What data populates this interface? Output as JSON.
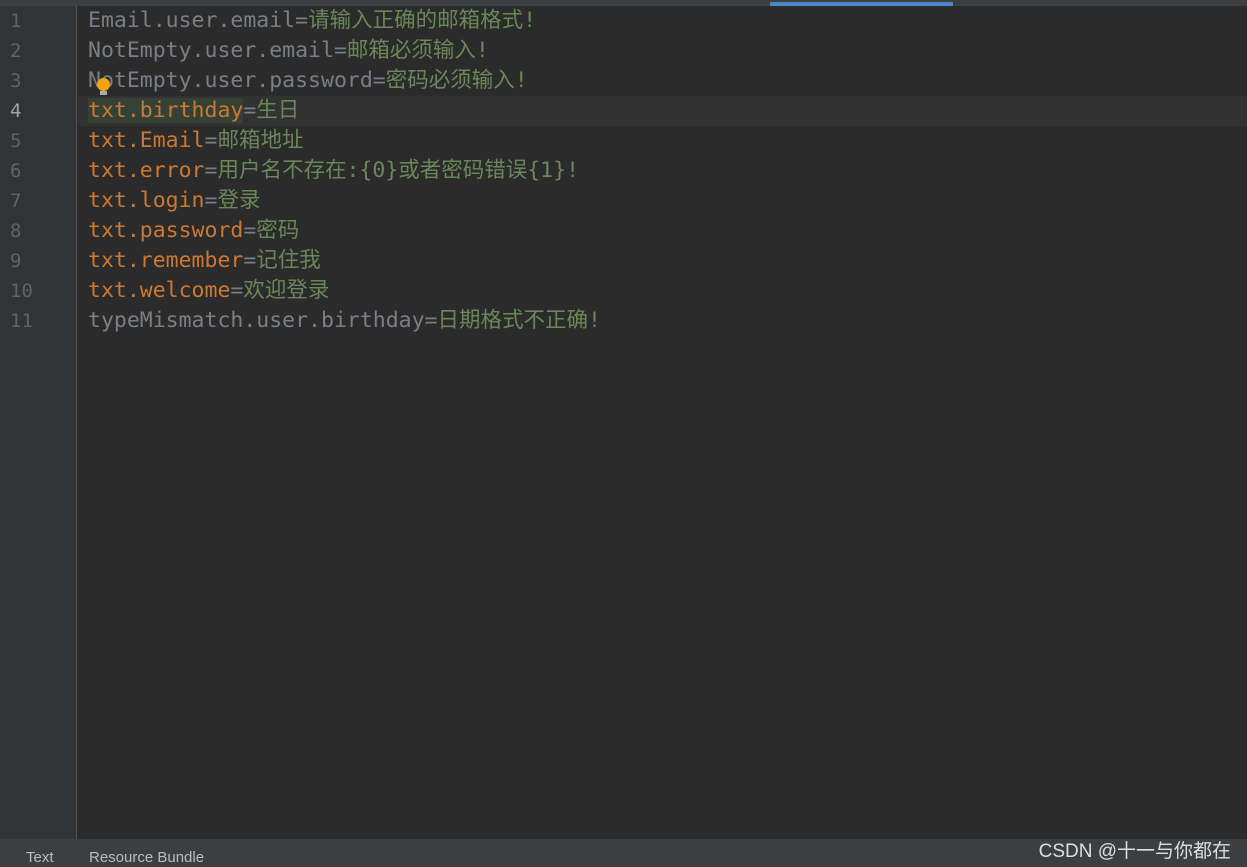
{
  "editor": {
    "current_line": 4,
    "lines": [
      {
        "n": "1",
        "key": "Email.user.email",
        "value": "请输入正确的邮箱格式!",
        "style": "gray"
      },
      {
        "n": "2",
        "key": "NotEmpty.user.email",
        "value": "邮箱必须输入!",
        "style": "gray"
      },
      {
        "n": "3",
        "key": "NotEmpty.user.password",
        "value": "密码必须输入!",
        "style": "gray"
      },
      {
        "n": "4",
        "key": "txt.birthday",
        "value": "生日",
        "style": "orange"
      },
      {
        "n": "5",
        "key": "txt.Email",
        "value": "邮箱地址",
        "style": "orange"
      },
      {
        "n": "6",
        "key": "txt.error",
        "value": "用户名不存在:{0}或者密码错误{1}!",
        "style": "orange"
      },
      {
        "n": "7",
        "key": "txt.login",
        "value": "登录",
        "style": "orange"
      },
      {
        "n": "8",
        "key": "txt.password",
        "value": "密码",
        "style": "orange"
      },
      {
        "n": "9",
        "key": "txt.remember",
        "value": "记住我",
        "style": "orange"
      },
      {
        "n": "10",
        "key": "txt.welcome",
        "value": "欢迎登录",
        "style": "orange"
      },
      {
        "n": "11",
        "key": "typeMismatch.user.birthday",
        "value": "日期格式不正确!",
        "style": "gray"
      }
    ],
    "separator": "="
  },
  "bottom_tabs": [
    {
      "label": "Text"
    },
    {
      "label": "Resource Bundle"
    }
  ],
  "watermark": "CSDN @十一与你都在",
  "colors": {
    "key": "#7a7e85",
    "key_accent": "#cc7832",
    "value": "#6a8759",
    "background": "#2b2b2b"
  }
}
